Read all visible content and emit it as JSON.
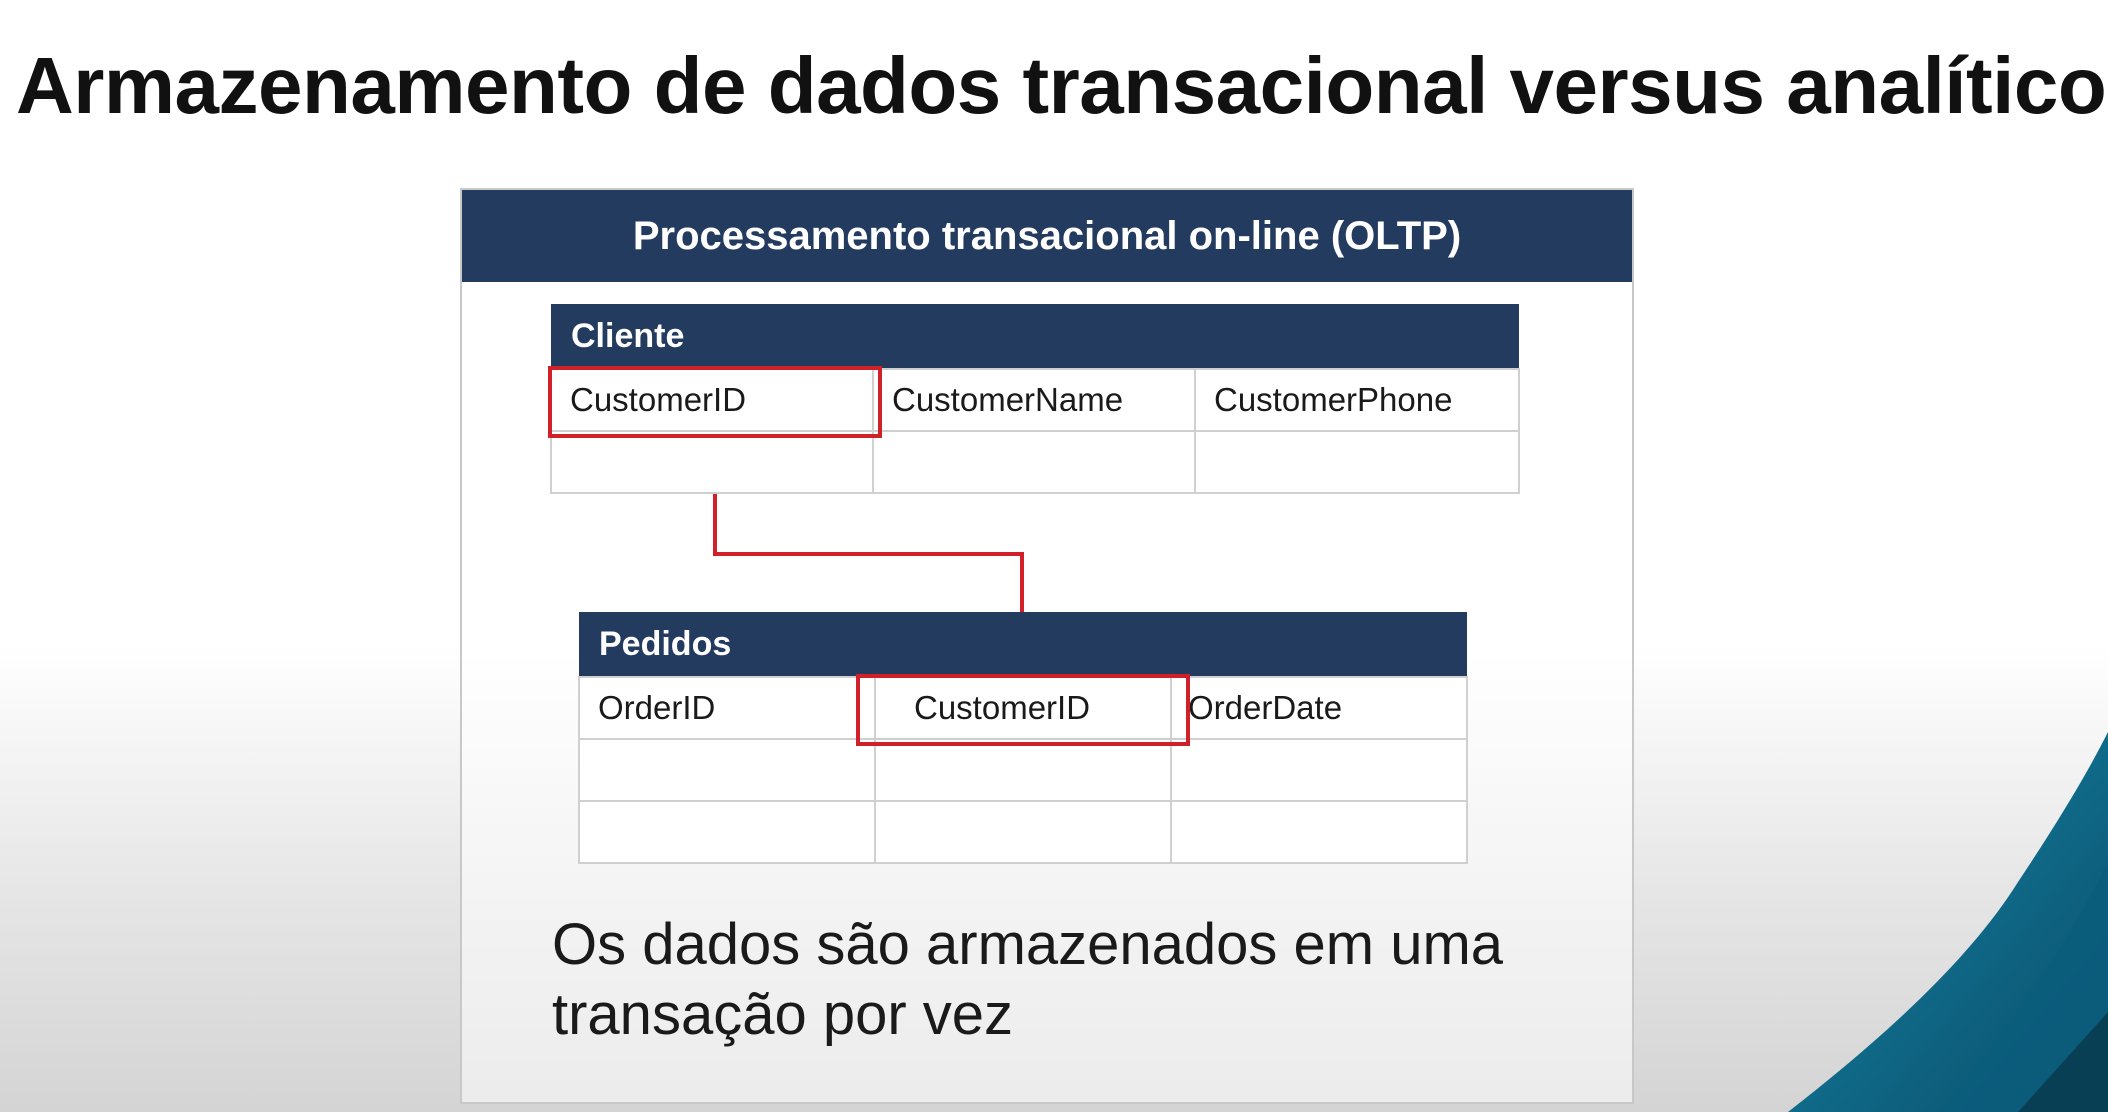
{
  "slide": {
    "title": "Armazenamento de dados transacional versus analítico"
  },
  "panel": {
    "header": "Processamento transacional on-line (OLTP)",
    "caption": "Os dados são armazenados em uma transação por vez"
  },
  "tables": {
    "cliente": {
      "name": "Cliente",
      "columns": [
        "CustomerID",
        "CustomerName",
        "CustomerPhone"
      ]
    },
    "pedidos": {
      "name": "Pedidos",
      "columns": [
        "OrderID",
        "CustomerID",
        "OrderDate"
      ]
    }
  },
  "colors": {
    "header_navy": "#243b60",
    "highlight_red": "#d0202a",
    "accent_teal": "#0f6f8f"
  }
}
